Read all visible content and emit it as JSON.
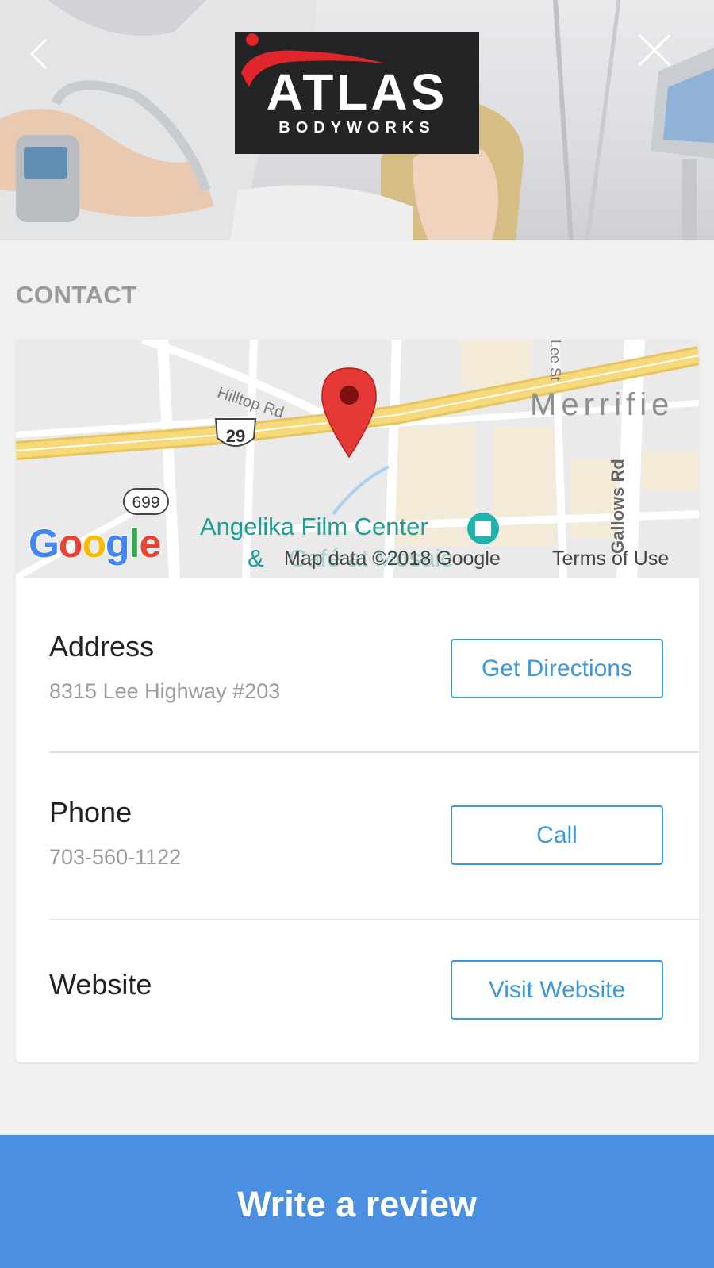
{
  "header": {
    "brand": {
      "name": "ATLAS",
      "tagline": "BODYWORKS"
    },
    "back_icon": "chevron-left-icon",
    "close_icon": "close-icon"
  },
  "contact": {
    "section_title": "CONTACT",
    "map": {
      "place_labels": {
        "merrifield": "Merrifie",
        "angelika_line1": "Angelika Film Center",
        "angelika_line2": "&",
        "angelika_faded": "Café at Mosaic",
        "hilltop": "Hilltop Rd",
        "gallows": "Gallows Rd",
        "lee_st": "Lee St",
        "route_29": "29",
        "route_699": "699"
      },
      "attribution": "Map data ©2018 Google",
      "terms": "Terms of Use",
      "google_logo": {
        "g1": "G",
        "o1": "o",
        "o2": "o",
        "g2": "g",
        "l": "l",
        "e": "e"
      }
    },
    "rows": [
      {
        "label": "Address",
        "value": "8315 Lee Highway #203",
        "button": "Get Directions"
      },
      {
        "label": "Phone",
        "value": "703-560-1122",
        "button": "Call"
      },
      {
        "label": "Website",
        "value": "",
        "button": "Visit Website"
      }
    ]
  },
  "footer": {
    "cta_label": "Write a review"
  },
  "colors": {
    "accent_blue": "#3b98dd",
    "cta_blue": "#4a8fe0",
    "pin_red": "#e53935",
    "highway_yellow": "#f6d877"
  }
}
